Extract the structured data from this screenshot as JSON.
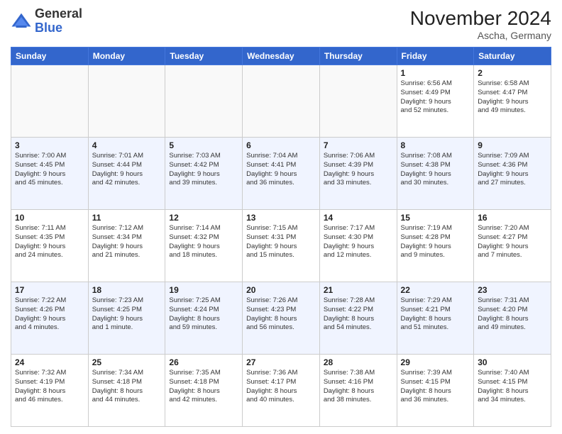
{
  "header": {
    "logo_general": "General",
    "logo_blue": "Blue",
    "month_title": "November 2024",
    "location": "Ascha, Germany"
  },
  "weekdays": [
    "Sunday",
    "Monday",
    "Tuesday",
    "Wednesday",
    "Thursday",
    "Friday",
    "Saturday"
  ],
  "weeks": [
    [
      {
        "day": "",
        "info": "",
        "empty": true
      },
      {
        "day": "",
        "info": "",
        "empty": true
      },
      {
        "day": "",
        "info": "",
        "empty": true
      },
      {
        "day": "",
        "info": "",
        "empty": true
      },
      {
        "day": "",
        "info": "",
        "empty": true
      },
      {
        "day": "1",
        "info": "Sunrise: 6:56 AM\nSunset: 4:49 PM\nDaylight: 9 hours\nand 52 minutes."
      },
      {
        "day": "2",
        "info": "Sunrise: 6:58 AM\nSunset: 4:47 PM\nDaylight: 9 hours\nand 49 minutes."
      }
    ],
    [
      {
        "day": "3",
        "info": "Sunrise: 7:00 AM\nSunset: 4:45 PM\nDaylight: 9 hours\nand 45 minutes."
      },
      {
        "day": "4",
        "info": "Sunrise: 7:01 AM\nSunset: 4:44 PM\nDaylight: 9 hours\nand 42 minutes."
      },
      {
        "day": "5",
        "info": "Sunrise: 7:03 AM\nSunset: 4:42 PM\nDaylight: 9 hours\nand 39 minutes."
      },
      {
        "day": "6",
        "info": "Sunrise: 7:04 AM\nSunset: 4:41 PM\nDaylight: 9 hours\nand 36 minutes."
      },
      {
        "day": "7",
        "info": "Sunrise: 7:06 AM\nSunset: 4:39 PM\nDaylight: 9 hours\nand 33 minutes."
      },
      {
        "day": "8",
        "info": "Sunrise: 7:08 AM\nSunset: 4:38 PM\nDaylight: 9 hours\nand 30 minutes."
      },
      {
        "day": "9",
        "info": "Sunrise: 7:09 AM\nSunset: 4:36 PM\nDaylight: 9 hours\nand 27 minutes."
      }
    ],
    [
      {
        "day": "10",
        "info": "Sunrise: 7:11 AM\nSunset: 4:35 PM\nDaylight: 9 hours\nand 24 minutes."
      },
      {
        "day": "11",
        "info": "Sunrise: 7:12 AM\nSunset: 4:34 PM\nDaylight: 9 hours\nand 21 minutes."
      },
      {
        "day": "12",
        "info": "Sunrise: 7:14 AM\nSunset: 4:32 PM\nDaylight: 9 hours\nand 18 minutes."
      },
      {
        "day": "13",
        "info": "Sunrise: 7:15 AM\nSunset: 4:31 PM\nDaylight: 9 hours\nand 15 minutes."
      },
      {
        "day": "14",
        "info": "Sunrise: 7:17 AM\nSunset: 4:30 PM\nDaylight: 9 hours\nand 12 minutes."
      },
      {
        "day": "15",
        "info": "Sunrise: 7:19 AM\nSunset: 4:28 PM\nDaylight: 9 hours\nand 9 minutes."
      },
      {
        "day": "16",
        "info": "Sunrise: 7:20 AM\nSunset: 4:27 PM\nDaylight: 9 hours\nand 7 minutes."
      }
    ],
    [
      {
        "day": "17",
        "info": "Sunrise: 7:22 AM\nSunset: 4:26 PM\nDaylight: 9 hours\nand 4 minutes."
      },
      {
        "day": "18",
        "info": "Sunrise: 7:23 AM\nSunset: 4:25 PM\nDaylight: 9 hours\nand 1 minute."
      },
      {
        "day": "19",
        "info": "Sunrise: 7:25 AM\nSunset: 4:24 PM\nDaylight: 8 hours\nand 59 minutes."
      },
      {
        "day": "20",
        "info": "Sunrise: 7:26 AM\nSunset: 4:23 PM\nDaylight: 8 hours\nand 56 minutes."
      },
      {
        "day": "21",
        "info": "Sunrise: 7:28 AM\nSunset: 4:22 PM\nDaylight: 8 hours\nand 54 minutes."
      },
      {
        "day": "22",
        "info": "Sunrise: 7:29 AM\nSunset: 4:21 PM\nDaylight: 8 hours\nand 51 minutes."
      },
      {
        "day": "23",
        "info": "Sunrise: 7:31 AM\nSunset: 4:20 PM\nDaylight: 8 hours\nand 49 minutes."
      }
    ],
    [
      {
        "day": "24",
        "info": "Sunrise: 7:32 AM\nSunset: 4:19 PM\nDaylight: 8 hours\nand 46 minutes."
      },
      {
        "day": "25",
        "info": "Sunrise: 7:34 AM\nSunset: 4:18 PM\nDaylight: 8 hours\nand 44 minutes."
      },
      {
        "day": "26",
        "info": "Sunrise: 7:35 AM\nSunset: 4:18 PM\nDaylight: 8 hours\nand 42 minutes."
      },
      {
        "day": "27",
        "info": "Sunrise: 7:36 AM\nSunset: 4:17 PM\nDaylight: 8 hours\nand 40 minutes."
      },
      {
        "day": "28",
        "info": "Sunrise: 7:38 AM\nSunset: 4:16 PM\nDaylight: 8 hours\nand 38 minutes."
      },
      {
        "day": "29",
        "info": "Sunrise: 7:39 AM\nSunset: 4:15 PM\nDaylight: 8 hours\nand 36 minutes."
      },
      {
        "day": "30",
        "info": "Sunrise: 7:40 AM\nSunset: 4:15 PM\nDaylight: 8 hours\nand 34 minutes."
      }
    ]
  ]
}
